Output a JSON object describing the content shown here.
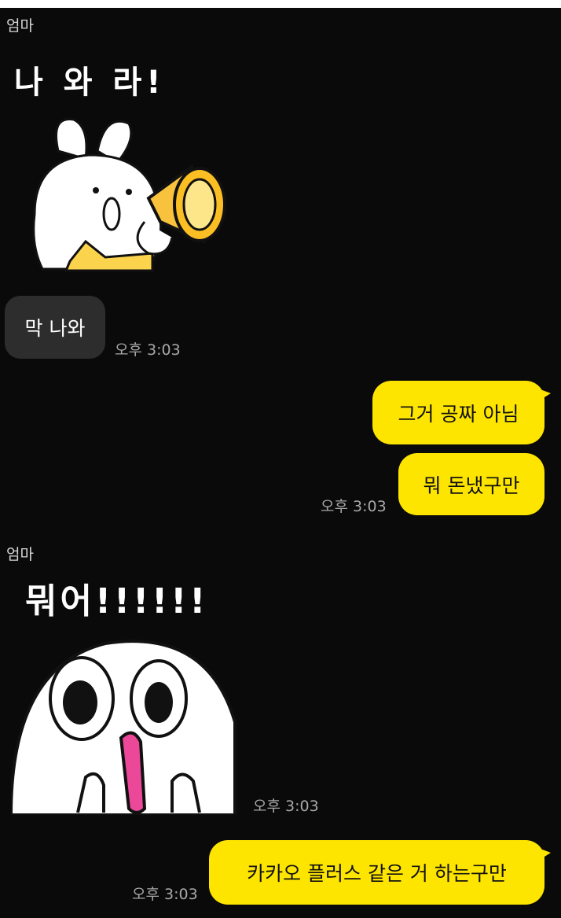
{
  "colors": {
    "background": "#0a0a0a",
    "my_bubble": "#fee500",
    "their_bubble": "#2d2d2d"
  },
  "messages": [
    {
      "sender": "엄마",
      "sticker_icon": "bunny-megaphone-sticker",
      "sticker_text": "나 와 라!"
    },
    {
      "text": "막 나와",
      "time": "오후 3:03"
    },
    {
      "text": "그거 공짜 아님"
    },
    {
      "text": "뭐 돈냈구만",
      "time": "오후 3:03"
    },
    {
      "sender": "엄마",
      "sticker_icon": "shocked-face-sticker",
      "sticker_text": "뭐어!!!!!!",
      "time": "오후 3:03"
    },
    {
      "text": "카카오 플러스 같은 거 하는구만",
      "time": "오후 3:03"
    }
  ]
}
